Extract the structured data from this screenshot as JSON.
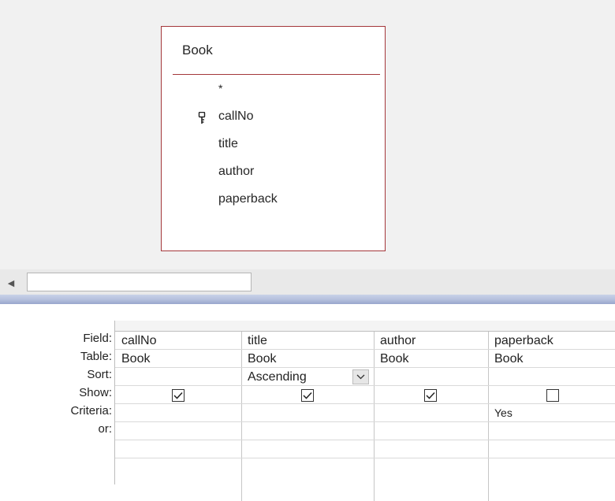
{
  "table": {
    "name": "Book",
    "fields": [
      {
        "name": "*",
        "primary_key": false
      },
      {
        "name": "callNo",
        "primary_key": true
      },
      {
        "name": "title",
        "primary_key": false
      },
      {
        "name": "author",
        "primary_key": false
      },
      {
        "name": "paperback",
        "primary_key": false
      }
    ]
  },
  "grid": {
    "row_labels": [
      "Field:",
      "Table:",
      "Sort:",
      "Show:",
      "Criteria:",
      "or:"
    ],
    "columns": [
      {
        "field": "callNo",
        "table": "Book",
        "sort": "",
        "show": true,
        "criteria": "",
        "or": ""
      },
      {
        "field": "title",
        "table": "Book",
        "sort": "Ascending",
        "show": true,
        "criteria": "",
        "or": ""
      },
      {
        "field": "author",
        "table": "Book",
        "sort": "",
        "show": true,
        "criteria": "",
        "or": ""
      },
      {
        "field": "paperback",
        "table": "Book",
        "sort": "",
        "show": false,
        "criteria": "Yes",
        "or": ""
      }
    ]
  },
  "icons": {
    "primary_key": "key-icon",
    "scroll_left": "left-arrow-icon",
    "sort_dropdown": "chevron-down-icon",
    "checkbox_checked": "checkmark-icon"
  },
  "colors": {
    "table_border": "#a4373a",
    "pane_background": "#f1f1f1",
    "splitter": "#b4bfdc"
  }
}
